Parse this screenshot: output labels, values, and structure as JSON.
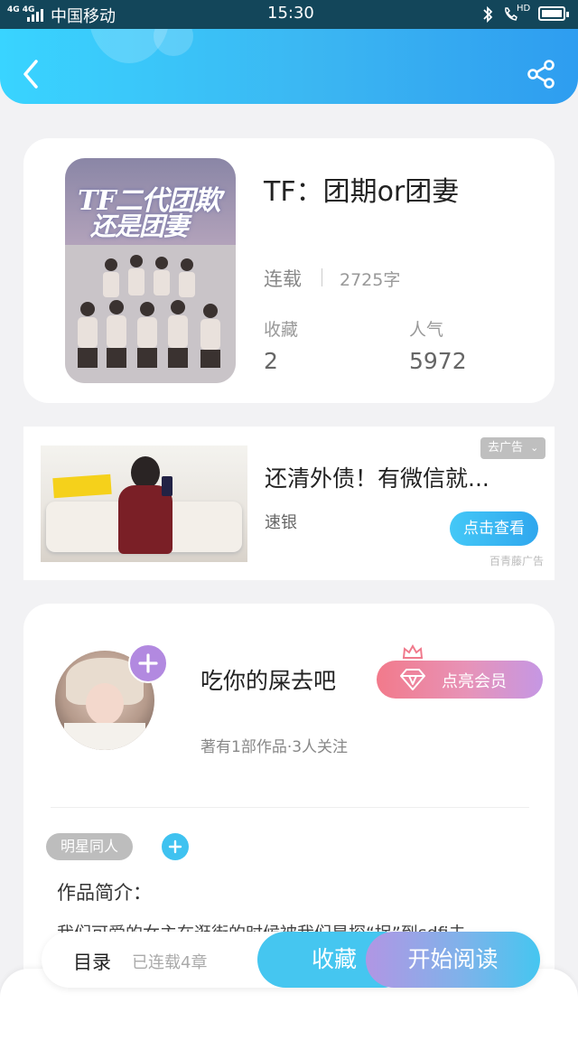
{
  "status_bar": {
    "carrier": "中国移动",
    "time": "15:30",
    "network_top": "4G 4G",
    "hd": "HD"
  },
  "book": {
    "cover_title_line1": "TF二代团欺",
    "cover_title_line2": "还是团妻",
    "title": "TF：团期or团妻",
    "status": "连载",
    "word_count": "2725字",
    "favorites_label": "收藏",
    "favorites_value": "2",
    "popularity_label": "人气",
    "popularity_value": "5972"
  },
  "ad": {
    "remove_label": "去广告",
    "title": "还清外债！有微信就...",
    "brand": "速银",
    "cta": "点击查看",
    "source": "百青藤广告"
  },
  "author": {
    "name": "吃你的屎去吧",
    "stats": "著有1部作品·3人关注",
    "vip_label": "点亮会员",
    "tag": "明星同人",
    "intro_label": "作品简介：",
    "intro_text": "我们可爱的女主在逛街的时候被我们星探“捉”到sdfi去"
  },
  "bottom_bar": {
    "catalog_label": "目录",
    "chapters": "已连载4章",
    "favorite_button": "收藏",
    "read_button": "开始阅读"
  },
  "colors": {
    "accent": "#3bc3f3",
    "vip": "#f07a8c",
    "purple": "#b18de2"
  }
}
